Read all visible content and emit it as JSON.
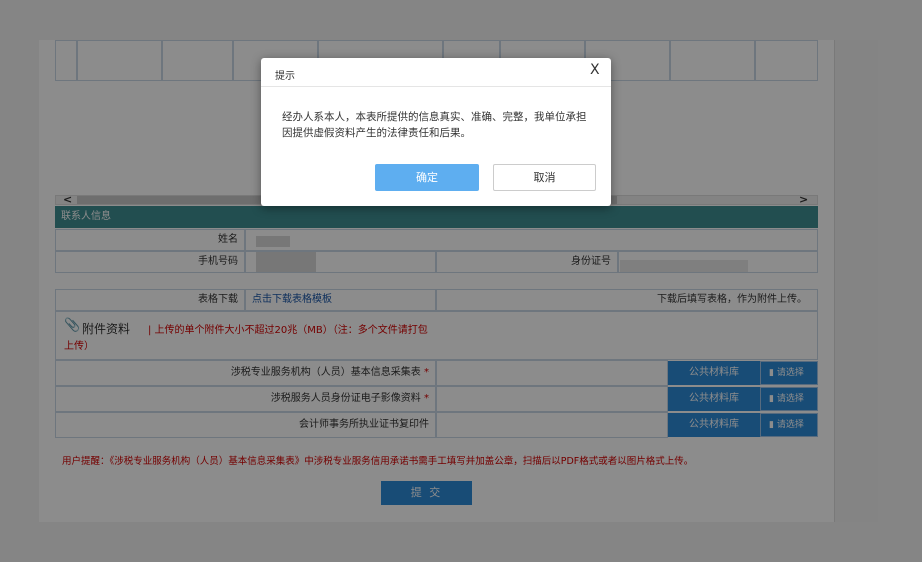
{
  "contact": {
    "header": "联系人信息",
    "name_label": "姓名",
    "phone_label": "手机号码",
    "id_label": "身份证号"
  },
  "download": {
    "label": "表格下载",
    "link": "点击下载表格模板",
    "note": "下载后填写表格，作为附件上传。"
  },
  "attachments": {
    "title": "附件资料",
    "note": "| 上传的单个附件大小不超过20兆（MB）（注：多个文件请打包上传）",
    "items": [
      {
        "label": "涉税专业服务机构（人员）基本信息采集表",
        "required": "*",
        "library": "公共材料库",
        "choose": "请选择"
      },
      {
        "label": "涉税服务人员身份证电子影像资料",
        "required": "*",
        "library": "公共材料库",
        "choose": "请选择"
      },
      {
        "label": "会计师事务所执业证书复印件",
        "required": "",
        "library": "公共材料库",
        "choose": "请选择"
      }
    ]
  },
  "reminder": "用户提醒：《涉税专业服务机构（人员）基本信息采集表》中涉税专业服务信用承诺书需手工填写并加盖公章，扫描后以PDF格式或者以图片格式上传。",
  "submit_label": "提 交",
  "scroll": {
    "left": "<",
    "right": ">"
  },
  "dialog": {
    "title": "提示",
    "close": "X",
    "message": "经办人系本人，本表所提供的信息真实、准确、完整，我单位承担因提供虚假资料产生的法律责任和后果。",
    "ok": "确定",
    "cancel": "取消"
  },
  "colors": {
    "teal": "#3f8e92",
    "blue": "#2d8ad8",
    "red": "#d40000"
  }
}
